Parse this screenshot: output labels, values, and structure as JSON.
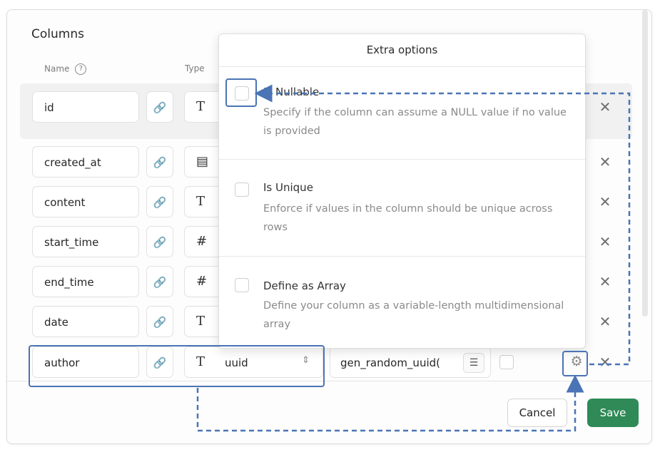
{
  "header": {
    "title": "Columns",
    "col_name": "Name",
    "col_type": "Type"
  },
  "rows": [
    {
      "name": "id",
      "type_icon": "T"
    },
    {
      "name": "created_at",
      "type_icon": "▤"
    },
    {
      "name": "content",
      "type_icon": "T"
    },
    {
      "name": "start_time",
      "type_icon": "#"
    },
    {
      "name": "end_time",
      "type_icon": "#"
    },
    {
      "name": "date",
      "type_icon": "T"
    },
    {
      "name": "author",
      "type_icon": "T",
      "type_label": "uuid",
      "default_value": "gen_random_uuid("
    }
  ],
  "popover": {
    "title": "Extra options",
    "options": [
      {
        "label": "Is Nullable",
        "description": "Specify if the column can assume a NULL value if no value is provided"
      },
      {
        "label": "Is Unique",
        "description": "Enforce if values in the column should be unique across rows"
      },
      {
        "label": "Define as Array",
        "description": "Define your column as a variable-length multidimensional array"
      }
    ]
  },
  "footer": {
    "cancel_label": "Cancel",
    "save_label": "Save"
  },
  "icons": {
    "link": "link-icon",
    "gear": "gear-icon",
    "close": "close-icon",
    "help": "help-icon",
    "list": "list-icon",
    "chevron": "chevron-updown-icon"
  },
  "colors": {
    "accent_green": "#2f8a57",
    "highlight_blue": "#4a74b5"
  }
}
